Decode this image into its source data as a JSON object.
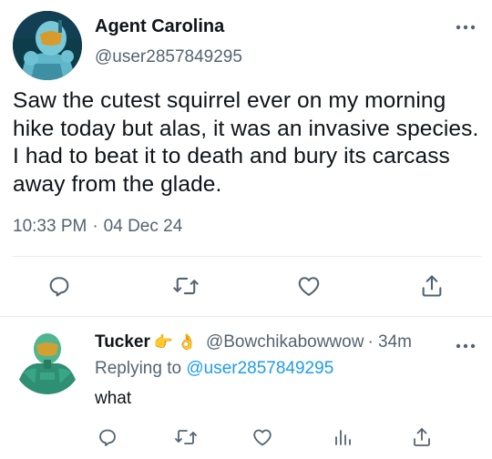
{
  "main_tweet": {
    "author_name": "Agent Carolina",
    "author_handle": "@user2857849295",
    "text": "Saw the cutest squirrel ever on my morning hike today but alas, it was an invasive species. I had to beat it to death and bury its carcass away from the glade.",
    "time": "10:33 PM",
    "separator": "·",
    "date": "04 Dec 24",
    "actions": [
      "reply-icon",
      "retweet-icon",
      "like-icon",
      "share-icon"
    ]
  },
  "reply": {
    "author_name": "Tucker",
    "author_emoji": "👉 👌",
    "author_handle": "@Bowchikabowwow",
    "time": "· 34m",
    "replying_prefix": "Replying to",
    "replying_mention": "@user2857849295",
    "text": "what",
    "actions": [
      "reply-icon",
      "retweet-icon",
      "like-icon",
      "analytics-icon",
      "share-icon"
    ]
  },
  "colors": {
    "text": "#0f1419",
    "secondary": "#536471",
    "accent": "#1d9bf0",
    "divider": "#e6ecf0"
  }
}
